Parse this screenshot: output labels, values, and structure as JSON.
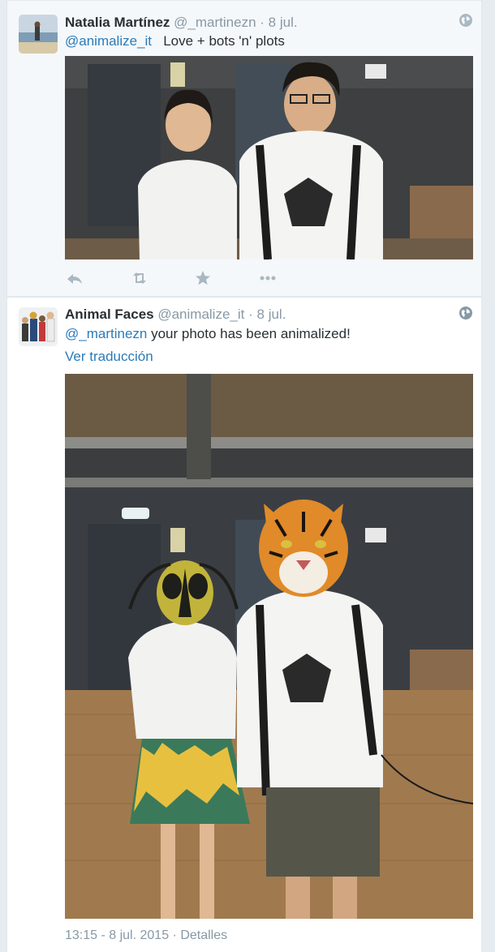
{
  "tweets": [
    {
      "name": "Natalia Martínez",
      "handle": "@_martinezn",
      "sep": "·",
      "date": "8 jul.",
      "mention": "@animalize_it",
      "text": "Love + bots 'n' plots",
      "icons": {
        "avatar": "avatar-beach-photo",
        "privacy": "globe-icon"
      }
    },
    {
      "name": "Animal Faces",
      "handle": "@animalize_it",
      "sep": "·",
      "date": "8 jul.",
      "mention": "@_martinezn",
      "text": "your photo has been animalized!",
      "translate": "Ver traducción",
      "timestamp": "13:15 - 8 jul. 2015 · Detalles",
      "icons": {
        "avatar": "avatar-group-photo",
        "privacy": "globe-icon"
      }
    }
  ],
  "actions": [
    {
      "name": "reply",
      "icon": "reply-icon"
    },
    {
      "name": "retweet",
      "icon": "retweet-icon"
    },
    {
      "name": "favorite",
      "icon": "star-icon"
    },
    {
      "name": "more",
      "icon": "more-icon"
    }
  ],
  "colors": {
    "link": "#2b7bb9",
    "meta": "#8899a6",
    "text": "#292f33",
    "icon": "#aab8c2"
  }
}
